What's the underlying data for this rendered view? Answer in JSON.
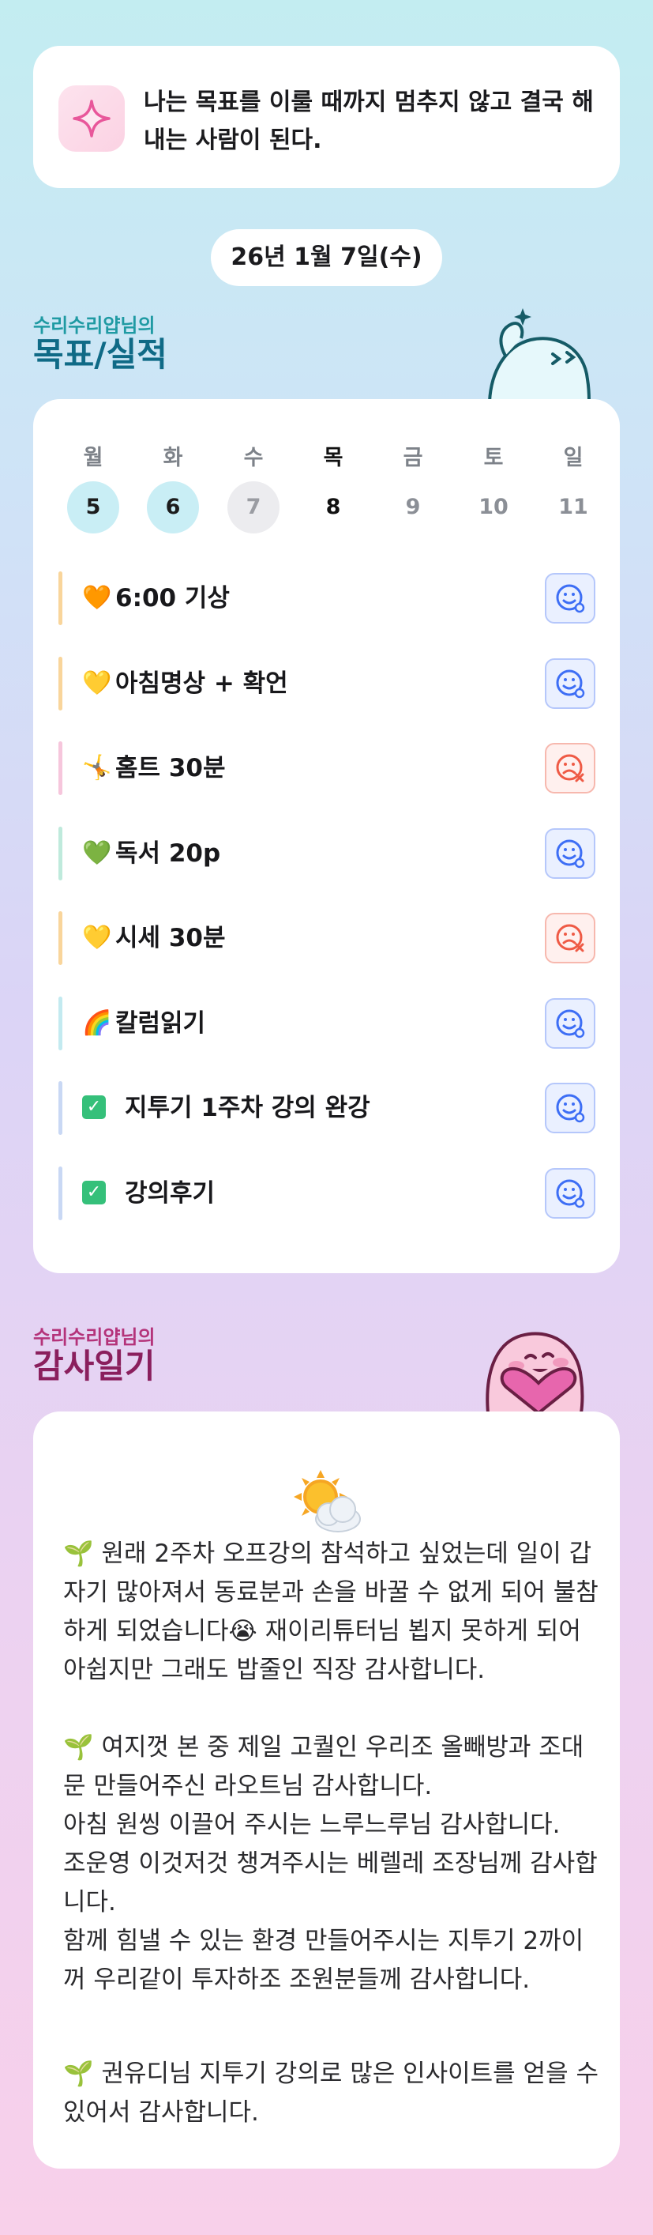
{
  "motto": {
    "icon": "sparkle-icon",
    "text": "나는 목표를 이룰 때까지 멈추지 않고 결국 해내는 사람이 된다."
  },
  "date": "26년 1월 7일(수)",
  "goals_section": {
    "owner": "수리수리얍님의",
    "title": "목표/실적"
  },
  "week": {
    "days": [
      {
        "name": "월",
        "num": "5"
      },
      {
        "name": "화",
        "num": "6"
      },
      {
        "name": "수",
        "num": "7"
      },
      {
        "name": "목",
        "num": "8"
      },
      {
        "name": "금",
        "num": "9"
      },
      {
        "name": "토",
        "num": "10"
      },
      {
        "name": "일",
        "num": "11"
      }
    ]
  },
  "goals": [
    {
      "emoji": "🧡",
      "label": "6:00 기상",
      "status": "success",
      "color": "#f9d59b"
    },
    {
      "emoji": "💛",
      "label": "아침명상 + 확언",
      "status": "success",
      "color": "#f9d59b"
    },
    {
      "emoji": "🤸",
      "label": "홈트 30분",
      "status": "fail",
      "color": "#f6c6dc"
    },
    {
      "emoji": "💚",
      "label": "독서 20p",
      "status": "success",
      "color": "#bfeadc"
    },
    {
      "emoji": "💛",
      "label": "시세 30분",
      "status": "fail",
      "color": "#f9d59b"
    },
    {
      "emoji": "🌈",
      "label": "칼럼읽기",
      "status": "success",
      "color": "#c3eaf0"
    },
    {
      "emoji": "✅",
      "label": "지투기 1주차 강의 완강",
      "status": "success",
      "color": "#c9d8f4"
    },
    {
      "emoji": "✅",
      "label": "강의후기",
      "status": "success",
      "color": "#c9d8f4"
    }
  ],
  "diary_section": {
    "owner": "수리수리얍님의",
    "title": "감사일기"
  },
  "diary": {
    "weather_icon": "sun-behind-cloud-icon",
    "paragraphs": [
      "🌱 원래 2주차 오프강의 참석하고 싶었는데 일이 갑자기 많아져서 동료분과 손을 바꿀 수 없게 되어 불참하게 되었습니다😭 재이리튜터님 뵙지 못하게 되어 아쉽지만 그래도 밥줄인 직장 감사합니다.",
      "🌱 여지껏 본 중 제일 고퀄인 우리조 올빼방과 조대문 만들어주신 라오트님 감사합니다.\n아침 원씽 이끌어 주시는 느루느루님 감사합니다.\n조운영 이것저것 챙겨주시는 베렐레 조장님께 감사합니다.\n함께 힘낼 수 있는 환경 만들어주시는 지투기 2까이꺼 우리같이 투자하조 조원분들께 감사합니다.",
      "🌱 권유디님 지투기 강의로 많은 인사이트를 얻을 수 있어서 감사합니다."
    ]
  }
}
